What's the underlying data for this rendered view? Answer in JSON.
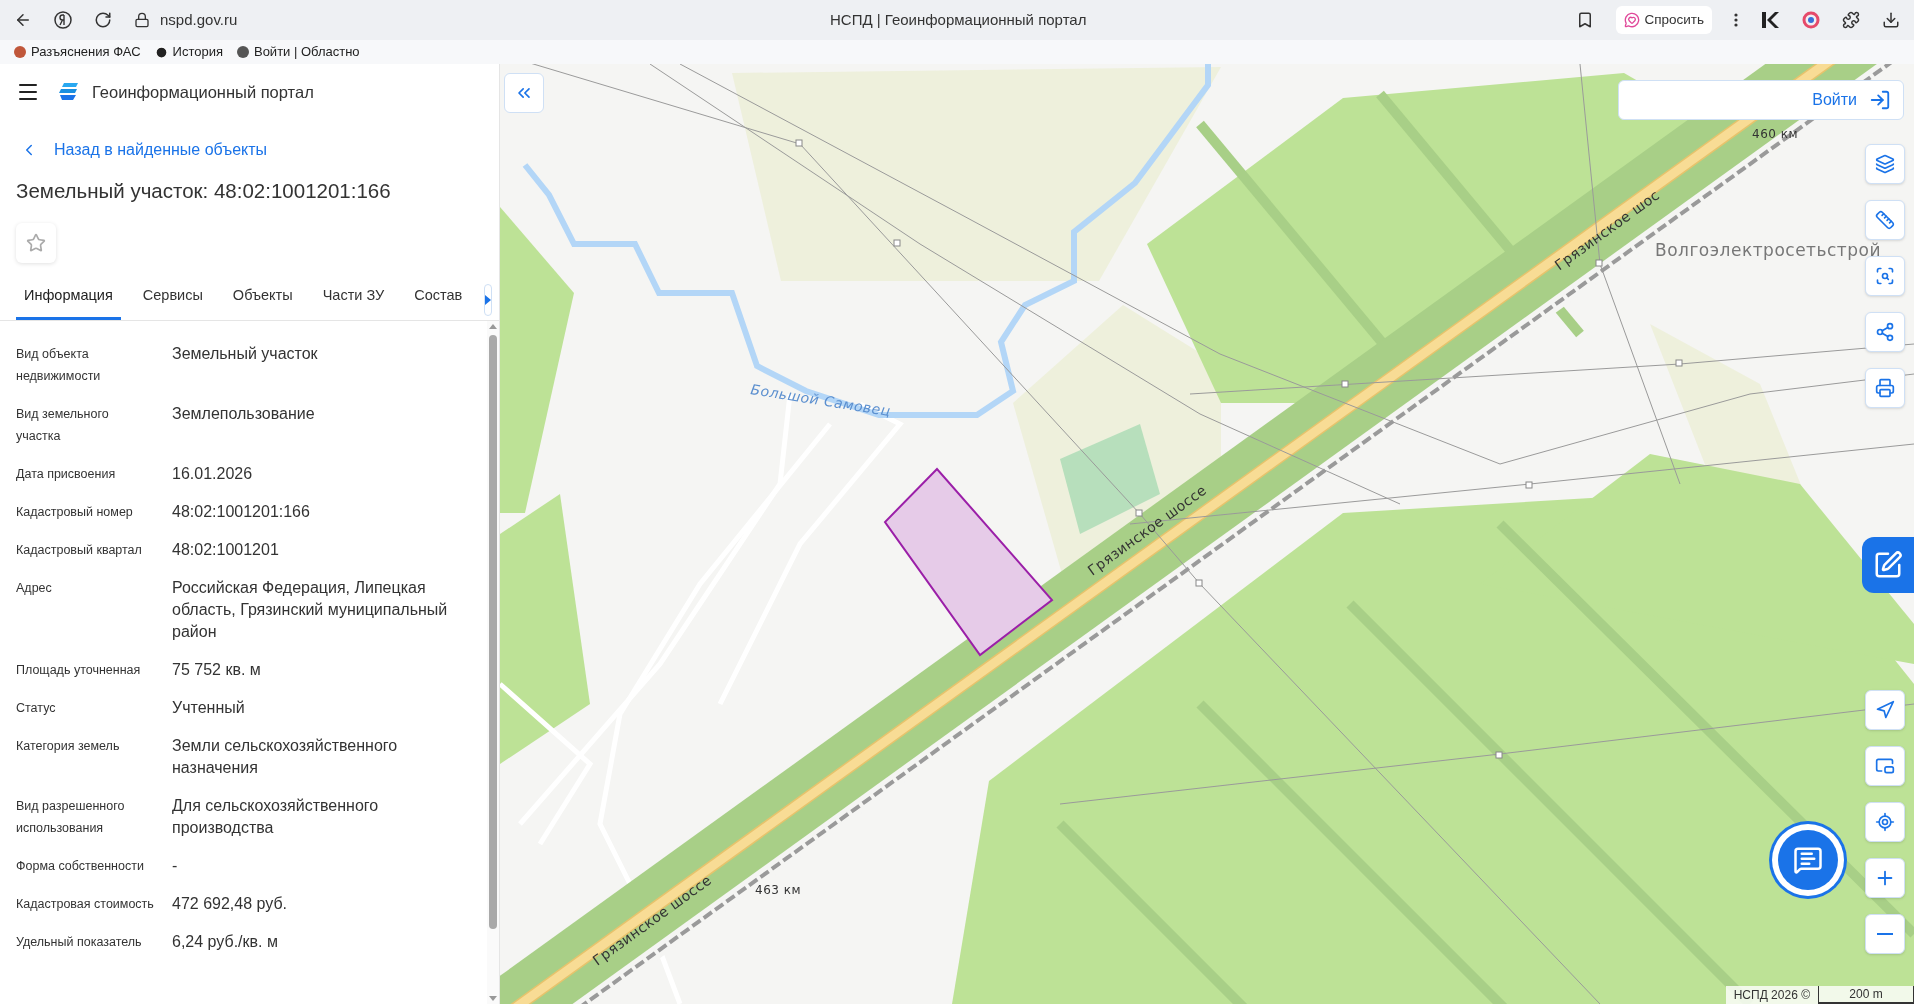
{
  "browser": {
    "url": "nspd.gov.ru",
    "title": "НСПД | Геоинформационный портал",
    "ask_button": "Спросить",
    "bookmarks": [
      {
        "label": "Разъяснения ФАС"
      },
      {
        "label": "История"
      },
      {
        "label": "Войти | Областно"
      }
    ]
  },
  "sidebar": {
    "app_title": "Геоинформационный портал",
    "back_link": "Назад в найденные объекты",
    "heading": "Земельный участок: 48:02:1001201:166",
    "favorite": false,
    "tabs": [
      {
        "label": "Информация",
        "selected": true
      },
      {
        "label": "Сервисы",
        "selected": false
      },
      {
        "label": "Объекты",
        "selected": false
      },
      {
        "label": "Части ЗУ",
        "selected": false
      },
      {
        "label": "Состав",
        "selected": false
      }
    ],
    "fields": [
      {
        "label": "Вид объекта недвижимости",
        "value": "Земельный участок"
      },
      {
        "label": "Вид земельного участка",
        "value": "Землепользование"
      },
      {
        "label": "Дата присвоения",
        "value": "16.01.2026"
      },
      {
        "label": "Кадастровый номер",
        "value": "48:02:1001201:166"
      },
      {
        "label": "Кадастровый квартал",
        "value": "48:02:1001201"
      },
      {
        "label": "Адрес",
        "value": "Российская Федерация, Липецкая область, Грязинский муниципальный район"
      },
      {
        "label": "Площадь уточненная",
        "value": "75 752 кв. м"
      },
      {
        "label": "Статус",
        "value": "Учтенный"
      },
      {
        "label": "Категория земель",
        "value": "Земли сельскохозяйственного назначения"
      },
      {
        "label": "Вид разрешенного использования",
        "value": "Для сельскохозяйственного производства"
      },
      {
        "label": "Форма собственности",
        "value": "-"
      },
      {
        "label": "Кадастровая стоимость",
        "value": "472 692,48 руб."
      },
      {
        "label": "Удельный показатель",
        "value": "6,24 руб./кв. м"
      }
    ]
  },
  "map": {
    "login_button": "Войти",
    "attribution": "НСПД 2026 ©",
    "scale": "200 m",
    "labels": [
      {
        "kind": "river",
        "text": "Большой Самовец"
      },
      {
        "kind": "road",
        "text": "Грязинское шоссе"
      },
      {
        "kind": "road",
        "text": "Грязинское шоссе"
      },
      {
        "kind": "road",
        "text": "Грязинское шос"
      },
      {
        "kind": "marker",
        "text": "460 км"
      },
      {
        "kind": "marker",
        "text": "463 км"
      },
      {
        "kind": "place",
        "text": "Волгоэлектросетьстрой"
      }
    ]
  }
}
